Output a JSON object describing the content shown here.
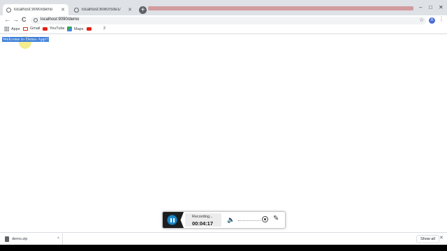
{
  "tabs": [
    {
      "title": "localhost:9090/demo",
      "active": true
    },
    {
      "title": "localhost:8080/Site1/",
      "active": false
    }
  ],
  "toolbar": {
    "back": "←",
    "forward": "→",
    "reload": "C",
    "url": "localhost:9090/demo",
    "star": "☆",
    "avatar_letter": "A",
    "menu": "⋮"
  },
  "window_controls": {
    "minimize": "–",
    "maximize": "□",
    "close": "✕"
  },
  "bookmarks": [
    {
      "label": "Apps",
      "icon": "apps-grid-icon"
    },
    {
      "label": "Gmail",
      "icon": "gmail-icon"
    },
    {
      "label": "YouTube",
      "icon": "youtube-icon"
    },
    {
      "label": "Maps",
      "icon": "maps-icon"
    },
    {
      "label": "2",
      "icon": "youtube-icon"
    }
  ],
  "page": {
    "text": "Welcome to Demo App!!"
  },
  "recorder": {
    "status": "Recording...",
    "time": "00:04:17",
    "speaker": "🔈",
    "pen": "✎"
  },
  "downloads": {
    "file": "demo.zip",
    "chevron": "^",
    "show_all": "Show all",
    "close": "✕"
  },
  "colors": {
    "selection": "#3a7cd6",
    "cursor_highlight": "#f0e66a",
    "pause_button": "#1e88c8"
  }
}
